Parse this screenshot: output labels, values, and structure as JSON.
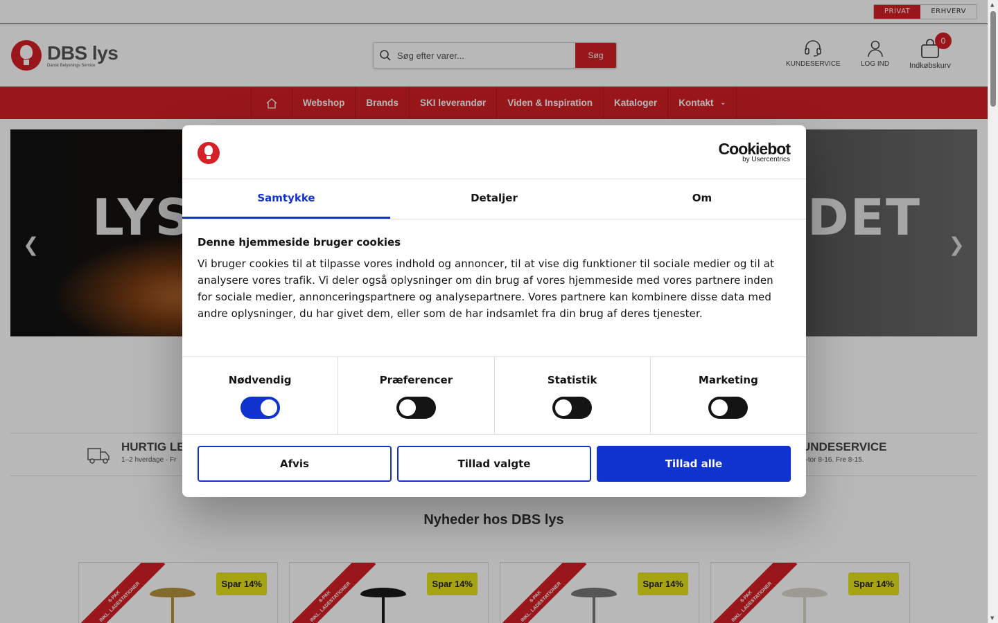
{
  "colors": {
    "brand_red": "#d42026",
    "cookie_blue": "#1032cf",
    "badge_yellow": "#e5e21a"
  },
  "topbar": {
    "privat": "PRIVAT",
    "erhverv": "ERHVERV"
  },
  "header": {
    "logo_name": "DBS lys",
    "logo_sub": "Dansk Belysnings Service",
    "search_placeholder": "Søg efter varer...",
    "search_button": "Søg",
    "kundeservice": "KUNDESERVICE",
    "login": "LOG IND",
    "cart": "Indkøbskurv",
    "cart_count": "0"
  },
  "nav": {
    "items": [
      "Webshop",
      "Brands",
      "SKI leverandør",
      "Viden & Inspiration",
      "Kataloger",
      "Kontakt"
    ]
  },
  "hero": {
    "text_left": "LYS,",
    "text_right": "DET"
  },
  "usp": {
    "left_title": "HURTIG LEV",
    "left_sub": "1–2 hverdage · Fr",
    "right_title": "UNDESERVICE",
    "right_sub": "n-tor 8-16. Fre 8-15."
  },
  "news_title": "Nyheder hos DBS lys",
  "cards": [
    {
      "ribbon": "6-PAK",
      "ribbon_sub": "INKL. LADESTATIONER",
      "badge": "Spar 14%",
      "shade": "#b8923e"
    },
    {
      "ribbon": "6-PAK",
      "ribbon_sub": "INKL. LADESTATIONER",
      "badge": "Spar 14%",
      "shade": "#1a1a1a"
    },
    {
      "ribbon": "6-PAK",
      "ribbon_sub": "INKL. LADESTATIONER",
      "badge": "Spar 14%",
      "shade": "#777777"
    },
    {
      "ribbon": "6-PAK",
      "ribbon_sub": "INKL. LADESTATIONER",
      "badge": "Spar 14%",
      "shade": "#d9d6cc"
    }
  ],
  "cookie": {
    "brand": "Cookiebot",
    "brand_sub": "by Usercentrics",
    "tabs": [
      "Samtykke",
      "Detaljer",
      "Om"
    ],
    "title": "Denne hjemmeside bruger cookies",
    "text": "Vi bruger cookies til at tilpasse vores indhold og annoncer, til at vise dig funktioner til sociale medier og til at analysere vores trafik. Vi deler også oplysninger om din brug af vores hjemmeside med vores partnere inden for sociale medier, annonceringspartnere og analysepartnere. Vores partnere kan kombinere disse data med andre oplysninger, du har givet dem, eller som de har indsamlet fra din brug af deres tjenester.",
    "toggles": [
      {
        "label": "Nødvendig",
        "on": true
      },
      {
        "label": "Præferencer",
        "on": false
      },
      {
        "label": "Statistik",
        "on": false
      },
      {
        "label": "Marketing",
        "on": false
      }
    ],
    "buttons": {
      "reject": "Afvis",
      "allow_selected": "Tillad valgte",
      "allow_all": "Tillad alle"
    }
  }
}
